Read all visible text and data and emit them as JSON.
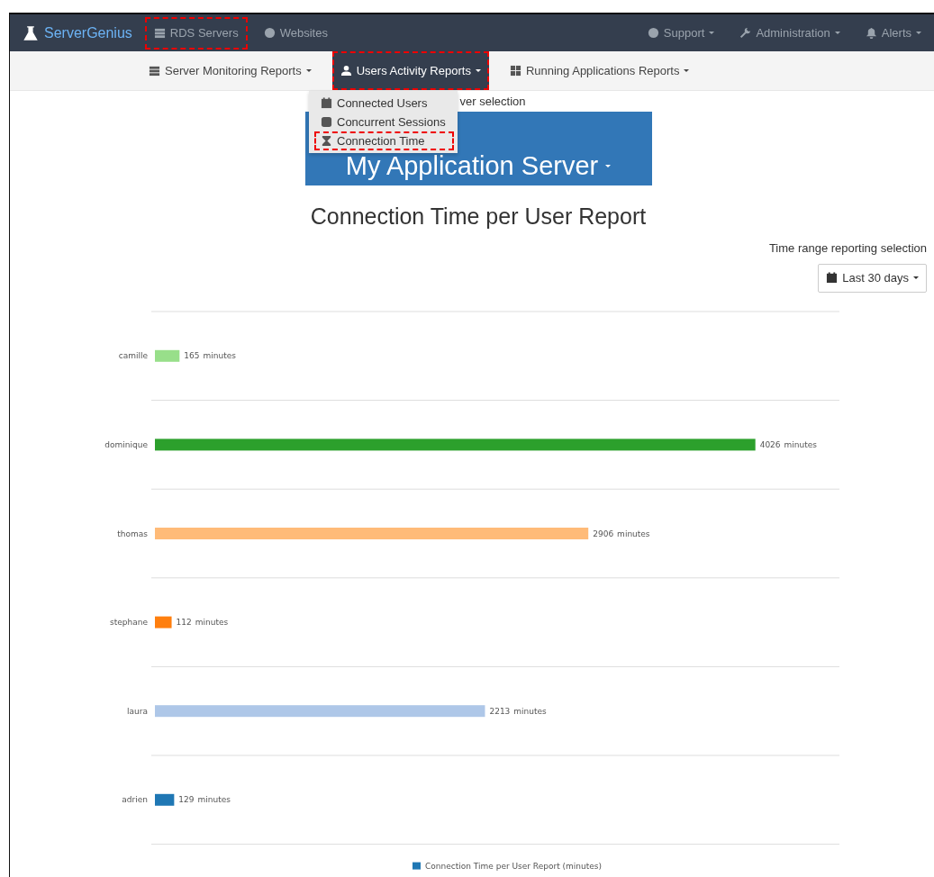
{
  "brand": {
    "name": "ServerGenius"
  },
  "top_nav": {
    "left": [
      {
        "label": "RDS Servers",
        "highlighted": true
      },
      {
        "label": "Websites",
        "highlighted": false
      }
    ],
    "right": [
      {
        "label": "Support"
      },
      {
        "label": "Administration"
      },
      {
        "label": "Alerts"
      }
    ]
  },
  "report_tabs": [
    {
      "label": "Server Monitoring Reports",
      "selected": false,
      "highlighted": false
    },
    {
      "label": "Users Activity Reports",
      "selected": true,
      "highlighted": true
    },
    {
      "label": "Running Applications Reports",
      "selected": false,
      "highlighted": false
    }
  ],
  "dropdown": {
    "items": [
      {
        "label": "Connected Users",
        "highlighted": false
      },
      {
        "label": "Concurrent Sessions",
        "highlighted": false
      },
      {
        "label": "Connection Time",
        "highlighted": true
      }
    ]
  },
  "server_selection": {
    "label": "ver selection",
    "server": "My Application Server"
  },
  "report_title": "Connection Time per User Report",
  "time_range": {
    "label": "Time range reporting selection",
    "value": "Last 30 days"
  },
  "chart": {
    "bars": [
      {
        "color": "#98df8a"
      },
      {
        "color": "#2ca02c"
      },
      {
        "color": "#ffbb78"
      },
      {
        "color": "#ff7f0e"
      },
      {
        "color": "#aec7e8"
      },
      {
        "color": "#1f77b4"
      }
    ],
    "legend": {
      "color": "#1f77b4"
    },
    "value_units": [
      "minutes",
      "minutes",
      "minutes",
      "minutes",
      "minutes",
      "minutes"
    ],
    "chart_data": {
      "type": "bar",
      "orientation": "horizontal",
      "data_labels": true,
      "categories": [
        "camille",
        "dominique",
        "thomas",
        "stephane",
        "laura",
        "adrien"
      ],
      "series": [
        {
          "name": "Connection Time per User Report (minutes)",
          "values": [
            165,
            4026,
            2906,
            112,
            2213,
            129
          ]
        }
      ]
    }
  }
}
